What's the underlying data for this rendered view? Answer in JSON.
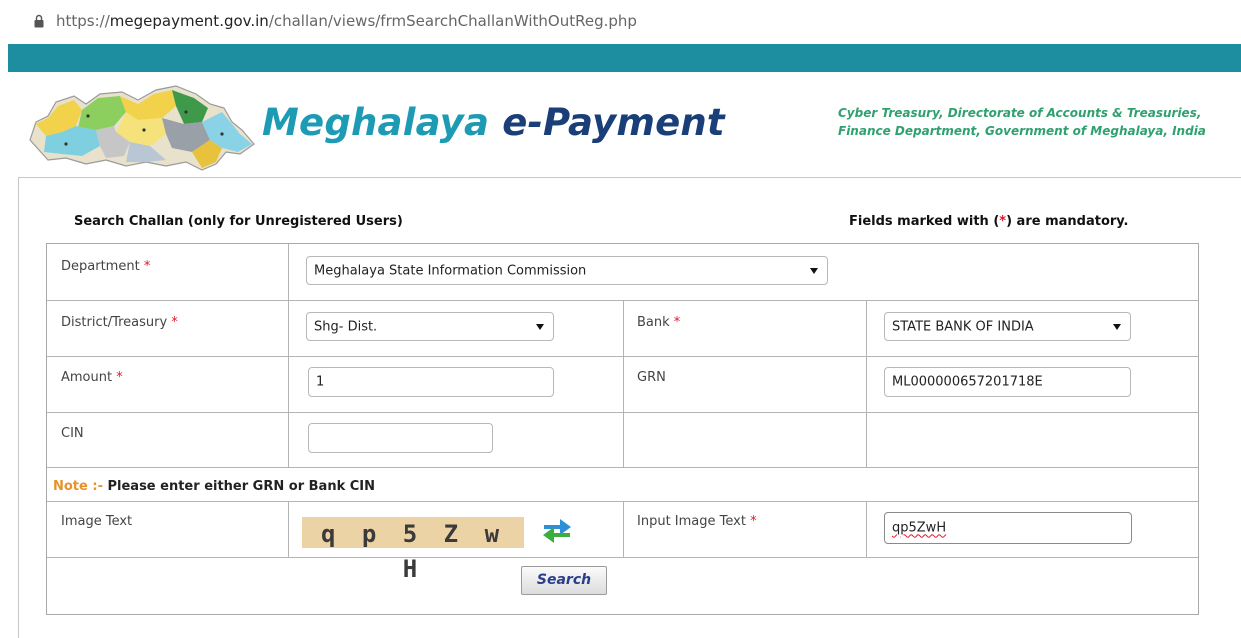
{
  "browser": {
    "url_scheme": "https://",
    "url_host": "megepayment.gov.in",
    "url_path": "/challan/views/frmSearchChallanWithOutReg.php"
  },
  "header": {
    "brand_part1": "Meghalaya",
    "brand_part2": " e-Payment",
    "tagline_line1": "Cyber Treasury, Directorate of Accounts & Treasuries,",
    "tagline_line2": "Finance Department, Government of Meghalaya, India"
  },
  "form": {
    "title": "Search Challan (only for Unregistered Users)",
    "mandatory_prefix": "Fields marked with (",
    "mandatory_star": "*",
    "mandatory_suffix": ") are mandatory.",
    "required_mark": "*",
    "department": {
      "label": "Department",
      "value": "Meghalaya State Information Commission"
    },
    "district": {
      "label": "District/Treasury",
      "value": "Shg- Dist."
    },
    "bank": {
      "label": "Bank",
      "value": "STATE BANK OF INDIA"
    },
    "amount": {
      "label": "Amount",
      "value": "1"
    },
    "grn": {
      "label": "GRN",
      "value": "ML000000657201718E"
    },
    "cin": {
      "label": "CIN",
      "value": ""
    },
    "note": {
      "key": "Note :-",
      "text": " Please enter either GRN or Bank CIN"
    },
    "image_text": {
      "label": "Image Text",
      "captcha": "q p 5 Z w H"
    },
    "input_image_text": {
      "label": "Input Image Text",
      "value": "qp5ZwH"
    },
    "search_button": "Search"
  },
  "colors": {
    "band": "#1d8ea0",
    "brand_light": "#1e9bb4",
    "brand_dark": "#1a3f78",
    "tagline": "#2ea16f",
    "required": "#e0142b",
    "note_key": "#e8922b",
    "captcha_bg": "#ecd3a6"
  },
  "icons": [
    "lock-icon",
    "meghalaya-map-logo",
    "refresh-captcha-icon",
    "dropdown-caret-icon"
  ]
}
